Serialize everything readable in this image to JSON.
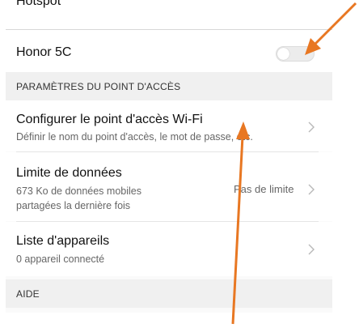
{
  "top_fragment": "Hotspot",
  "device": {
    "name": "Honor 5C",
    "toggle_on": false
  },
  "section_hotspot": "PARAMÈTRES DU POINT D'ACCÈS",
  "items": {
    "configure": {
      "title": "Configurer le point d'accès Wi-Fi",
      "subtitle": "Définir le nom du point d'accès, le mot de passe, etc."
    },
    "data_limit": {
      "title": "Limite de données",
      "subtitle_line1": "673 Ko de données mobiles",
      "subtitle_line2": "partagées la dernière fois",
      "value": "Pas de limite"
    },
    "devices": {
      "title": "Liste d'appareils",
      "subtitle": "0 appareil connecté"
    }
  },
  "section_help": "AIDE",
  "colors": {
    "annotation_arrow": "#e87722",
    "toggle_off": "#ececec"
  },
  "icons": [
    "chevron-right-icon",
    "annotation-arrow-icon"
  ]
}
